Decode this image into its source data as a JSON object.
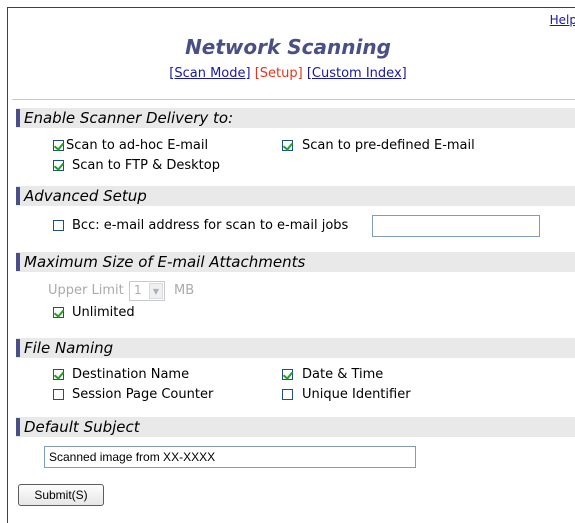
{
  "header": {
    "help_link": "Help",
    "title": "Network Scanning",
    "nav": {
      "scan_mode": "[Scan Mode]",
      "setup": "[Setup]",
      "custom_index": "[Custom Index]"
    }
  },
  "sections": {
    "enable_delivery": {
      "title": "Enable Scanner Delivery to:",
      "scan_email_adhoc": {
        "label": "Scan to ad-hoc E-mail",
        "checked": true
      },
      "scan_email_predefined": {
        "label": "Scan to pre-defined E-mail",
        "checked": true
      },
      "scan_ftp_desktop": {
        "label": "Scan to FTP & Desktop",
        "checked": true
      }
    },
    "advanced_setup": {
      "title": "Advanced Setup",
      "bcc": {
        "label": "Bcc: e-mail address for scan to e-mail jobs",
        "checked": false,
        "value": ""
      }
    },
    "max_size": {
      "title": "Maximum Size of E-mail Attachments",
      "upper_limit_label": "Upper Limit",
      "upper_limit_value": "1",
      "unit": "MB",
      "unlimited": {
        "label": "Unlimited",
        "checked": true
      }
    },
    "file_naming": {
      "title": "File Naming",
      "destination_name": {
        "label": "Destination Name",
        "checked": true
      },
      "date_time": {
        "label": "Date & Time",
        "checked": true
      },
      "session_page_counter": {
        "label": "Session Page Counter",
        "checked": false
      },
      "unique_identifier": {
        "label": "Unique Identifier",
        "checked": false
      }
    },
    "default_subject": {
      "title": "Default Subject",
      "value": "Scanned image from XX-XXXX"
    }
  },
  "submit_label": "Submit(S)"
}
